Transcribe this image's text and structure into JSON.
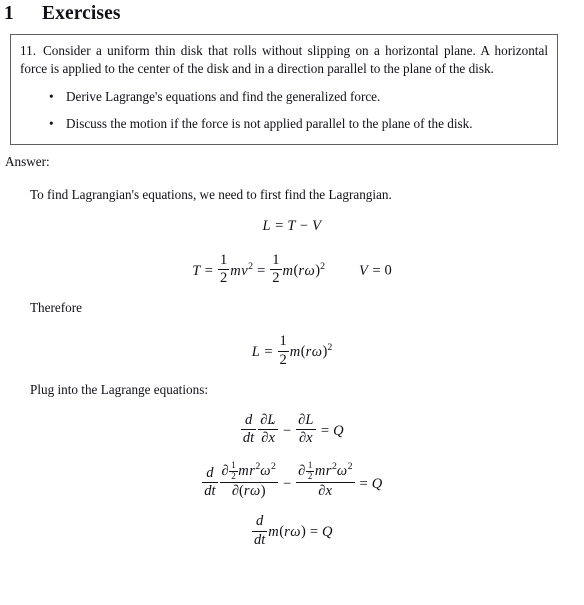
{
  "document": {
    "section": {
      "number": "1",
      "title": "Exercises"
    },
    "problem_box": {
      "question_number": "11.",
      "body": "Consider a uniform thin disk that rolls without slipping on a horizontal plane. A horizontal force is applied to the center of the disk and in a direction parallel to the plane of the disk.",
      "bullet_symbol": "•",
      "bullets": [
        "Derive Lagrange's equations and find the generalized force.",
        "Discuss the motion if the force is not applied parallel to the plane of the disk."
      ]
    },
    "answer": {
      "label": "Answer:",
      "intro": "To find Lagrangian's equations, we need to first find the Lagrangian.",
      "therefore": "Therefore",
      "plug_in": "Plug into the Lagrange equations:"
    },
    "math": {
      "eq1": {
        "latex": "L = T - V",
        "L": "L",
        "equals": "=",
        "T": "T",
        "minus": "−",
        "V": "V"
      },
      "eq2": {
        "latex": "T = \\frac{1}{2} m v^2 = \\frac{1}{2} m (r\\omega)^2 \\qquad V = 0",
        "T": "T",
        "equals": "=",
        "one": "1",
        "two": "2",
        "m": "m",
        "v": "v",
        "exp2": "2",
        "lparen": "(",
        "r": "r",
        "omega": "ω",
        "rparen": ")",
        "V": "V",
        "zero": "0"
      },
      "eq3": {
        "latex": "L = \\frac{1}{2} m (r\\omega)^2",
        "L": "L",
        "equals": "=",
        "one": "1",
        "two": "2",
        "m": "m",
        "lparen": "(",
        "r": "r",
        "omega": "ω",
        "rparen": ")",
        "exp2": "2"
      },
      "eq4": {
        "latex": "\\frac{d}{dt}\\frac{\\partial L}{\\partial \\dot{x}} - \\frac{\\partial L}{\\partial x} = Q",
        "d": "d",
        "dt": "dt",
        "partial": "∂",
        "L": "L",
        "x": "x",
        "minus": "−",
        "equals": "=",
        "Q": "Q"
      },
      "eq5": {
        "latex": "\\frac{d}{dt}\\frac{\\partial \\frac{1}{2} m r^2 \\omega^2}{\\partial (r\\omega)} - \\frac{\\partial \\frac{1}{2} m r^2 \\omega^2}{\\partial x} = Q",
        "d": "d",
        "dt": "dt",
        "partial": "∂",
        "one": "1",
        "two": "2",
        "m": "m",
        "r": "r",
        "exp2": "2",
        "omega": "ω",
        "lparen": "(",
        "rparen": ")",
        "x": "x",
        "minus": "−",
        "equals": "=",
        "Q": "Q"
      },
      "eq6": {
        "latex": "\\frac{d}{dt} m (r\\omega) = Q",
        "d": "d",
        "dt": "dt",
        "m": "m",
        "lparen": "(",
        "r": "r",
        "omega": "ω",
        "rparen": ")",
        "equals": "=",
        "Q": "Q"
      }
    },
    "colors": {
      "text": "#100f18",
      "box_border": "#5e5e5e",
      "background": "#ffffff"
    }
  }
}
